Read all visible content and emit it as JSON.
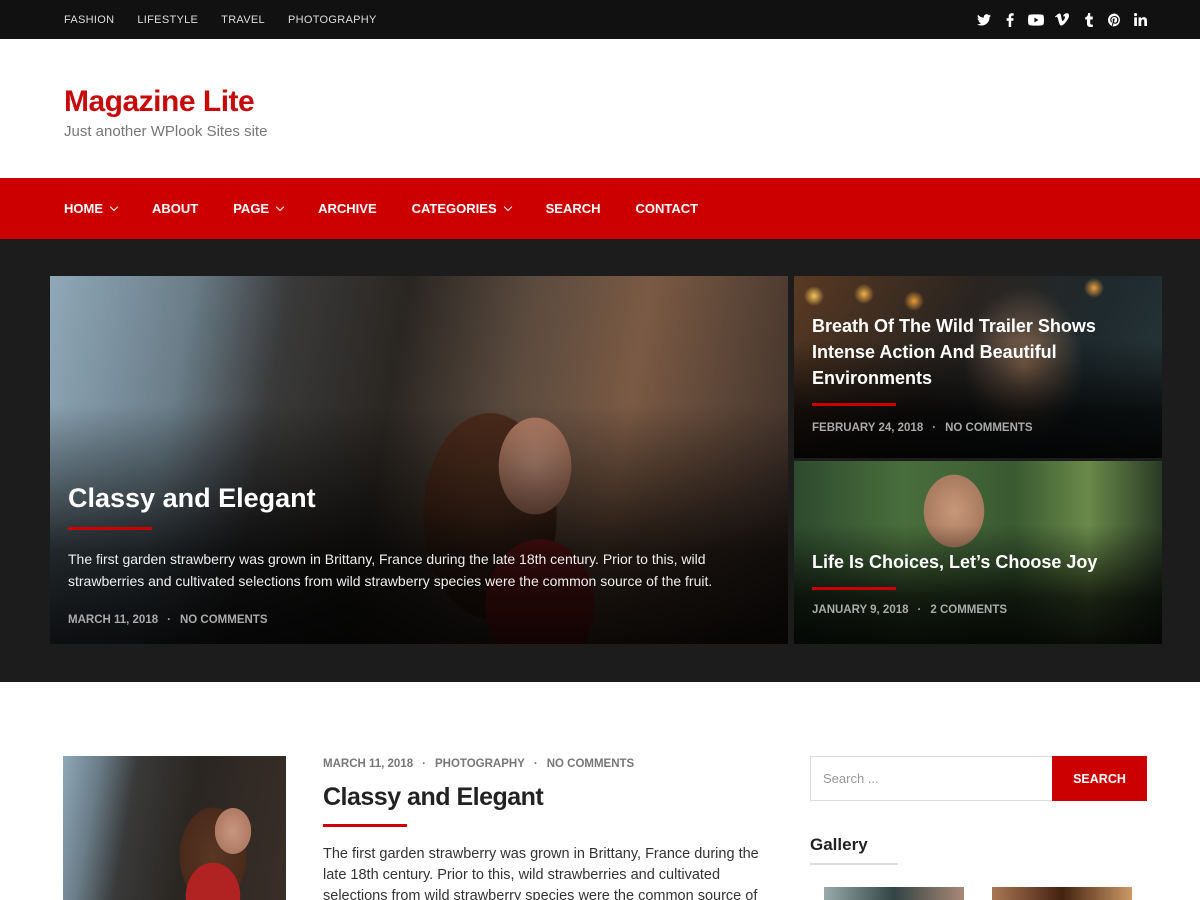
{
  "topbar": {
    "links": [
      "FASHION",
      "LIFESTYLE",
      "TRAVEL",
      "PHOTOGRAPHY"
    ],
    "social_icons": [
      "twitter-icon",
      "facebook-icon",
      "youtube-icon",
      "vimeo-icon",
      "tumblr-icon",
      "pinterest-icon",
      "linkedin-icon"
    ]
  },
  "header": {
    "title": "Magazine Lite",
    "description": "Just another WPlook Sites site"
  },
  "nav": {
    "home": "HOME",
    "about": "ABOUT",
    "page": "PAGE",
    "archive": "ARCHIVE",
    "categories": "CATEGORIES",
    "search": "SEARCH",
    "contact": "CONTACT"
  },
  "featured": {
    "main": {
      "title": "Classy and Elegant",
      "excerpt": "The first garden strawberry was grown in Brittany, France during the late 18th century. Prior to this, wild strawberries and cultivated selections from wild strawberry species were the common source of the fruit.",
      "date": "MARCH 11, 2018",
      "comments": "NO COMMENTS"
    },
    "side1": {
      "title": "Breath Of The Wild Trailer Shows Intense Action And Beautiful Environments",
      "date": "FEBRUARY 24, 2018",
      "comments": "NO COMMENTS"
    },
    "side2": {
      "title": "Life Is Choices, Let’s Choose Joy",
      "date": "JANUARY 9, 2018",
      "comments": "2 COMMENTS"
    }
  },
  "post": {
    "date": "MARCH 11, 2018",
    "category": "PHOTOGRAPHY",
    "comments": "NO COMMENTS",
    "title": "Classy and Elegant",
    "excerpt": "The first garden strawberry was grown in Brittany, France during the late 18th century. Prior to this, wild strawberries and cultivated selections from wild strawberry species were the common source of"
  },
  "sidebar": {
    "search_placeholder": "Search ...",
    "search_button": "SEARCH",
    "gallery_title": "Gallery"
  },
  "colors": {
    "accent": "#cc0000",
    "topbar": "#111111",
    "featured_bg": "#1c1c1c"
  }
}
